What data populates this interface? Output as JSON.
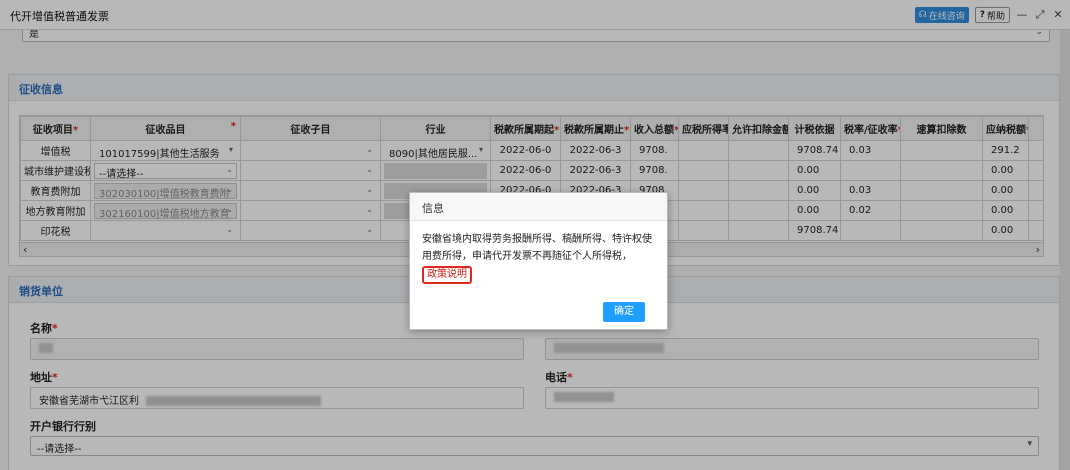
{
  "window": {
    "title": "代开增值税普通发票",
    "consult_label": "在线咨询",
    "help_label": "帮助",
    "min_glyph": "—",
    "max_glyph": "⤢",
    "close_glyph": "✕"
  },
  "top_select": {
    "value": "是"
  },
  "collection": {
    "header": "征收信息",
    "columns": [
      "征收项目",
      "征收品目",
      "征收子目",
      "行业",
      "税款所属期起",
      "税款所属期止",
      "收入总额",
      "应税所得率",
      "允许扣除金额",
      "计税依据",
      "税率/征收率",
      "速算扣除数",
      "应纳税额",
      "纳"
    ],
    "required_marks": [
      "*",
      "*",
      "*",
      "*",
      "*",
      "*",
      "*",
      "*"
    ],
    "rows": [
      {
        "item": "增值税",
        "category": "101017599|其他生活服务",
        "sub": "",
        "industry": "8090|其他居民服...",
        "start": "2022-06-0",
        "end": "2022-06-3",
        "income": "9708.",
        "rate_income": "",
        "deduct": "",
        "basis": "9708.74",
        "rate": "0.03",
        "quick": "",
        "tax": "291.2"
      },
      {
        "item": "城市维护建设税",
        "category": "--请选择--",
        "sub": "",
        "industry": "",
        "start": "2022-06-0",
        "end": "2022-06-3",
        "income": "9708.",
        "rate_income": "",
        "deduct": "",
        "basis": "0.00",
        "rate": "",
        "quick": "",
        "tax": "0.00"
      },
      {
        "item": "教育费附加",
        "category": "302030100|增值税教育费附",
        "sub": "",
        "industry": "",
        "start": "2022-06-0",
        "end": "2022-06-3",
        "income": "9708.",
        "rate_income": "",
        "deduct": "",
        "basis": "0.00",
        "rate": "0.03",
        "quick": "",
        "tax": "0.00"
      },
      {
        "item": "地方教育附加",
        "category": "302160100|增值税地方教育",
        "sub": "",
        "industry": "",
        "start": "2022-06-0",
        "end": "2022-06-3",
        "income": "9708.",
        "rate_income": "",
        "deduct": "",
        "basis": "0.00",
        "rate": "0.02",
        "quick": "",
        "tax": "0.00"
      },
      {
        "item": "印花税",
        "category": "",
        "sub": "",
        "industry": "",
        "start": "",
        "end": "",
        "income": "",
        "rate_income": "",
        "deduct": "",
        "basis": "9708.74",
        "rate": "",
        "quick": "",
        "tax": "0.00"
      }
    ]
  },
  "seller": {
    "header": "销货单位",
    "name_label": "名称",
    "address_label": "地址",
    "address_value": "安徽省芜湖市弋江区利",
    "phone_label": "电话",
    "bank_label": "开户银行行别",
    "bank_value": "--请选择--",
    "required_mark": "*"
  },
  "dialog": {
    "title": "信息",
    "message": "安徽省境内取得劳务报酬所得、稿酬所得、特许权使用费所得，申请代开发票不再随征个人所得税，",
    "link_label": "政策说明",
    "ok_label": "确定"
  }
}
